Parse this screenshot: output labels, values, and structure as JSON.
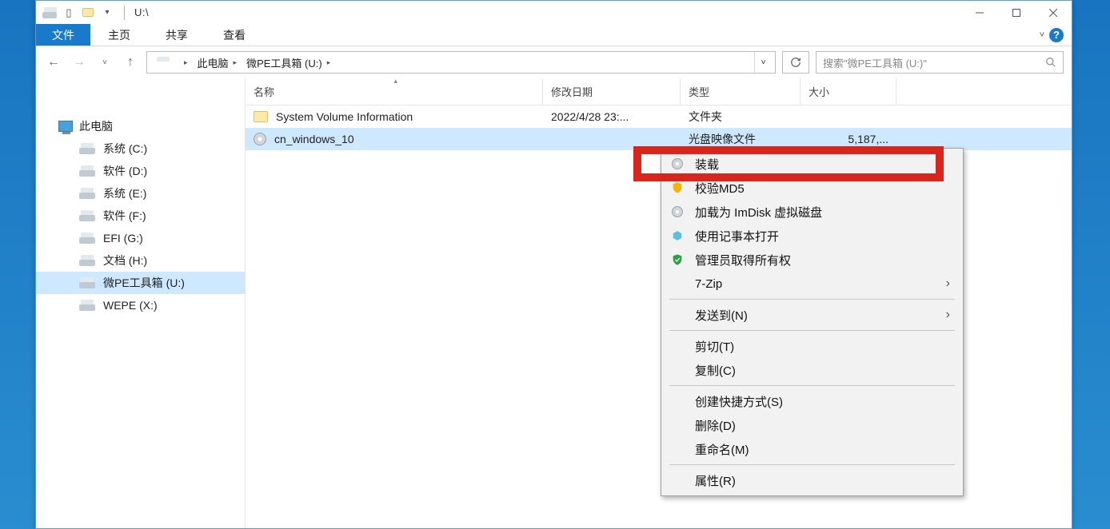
{
  "titlebar": {
    "path": "U:\\"
  },
  "ribbon": {
    "file": "文件",
    "home": "主页",
    "share": "共享",
    "view": "查看"
  },
  "breadcrumb": {
    "root": "此电脑",
    "drive": "微PE工具箱 (U:)"
  },
  "search": {
    "placeholder": "搜索\"微PE工具箱 (U:)\""
  },
  "columns": {
    "name": "名称",
    "date": "修改日期",
    "type": "类型",
    "size": "大小"
  },
  "sidebar": {
    "root": "此电脑",
    "items": [
      {
        "label": "系统 (C:)"
      },
      {
        "label": "软件 (D:)"
      },
      {
        "label": "系统 (E:)"
      },
      {
        "label": "软件 (F:)"
      },
      {
        "label": "EFI (G:)"
      },
      {
        "label": "文档 (H:)"
      },
      {
        "label": "微PE工具箱 (U:)"
      },
      {
        "label": "WEPE (X:)"
      }
    ]
  },
  "files": [
    {
      "name": "System Volume Information",
      "date": "2022/4/28 23:...",
      "type": "文件夹",
      "size": ""
    },
    {
      "name": "cn_windows_10",
      "date": "",
      "type": "光盘映像文件",
      "size": "5,187,..."
    }
  ],
  "context_menu": {
    "items": [
      {
        "label": "装载",
        "icon": "disc"
      },
      {
        "label": "校验MD5",
        "icon": "shield-yellow"
      },
      {
        "label": "加载为 ImDisk 虚拟磁盘",
        "icon": "disc"
      },
      {
        "label": "使用记事本打开",
        "icon": "cube"
      },
      {
        "label": "管理员取得所有权",
        "icon": "shield-green"
      },
      {
        "label": "7-Zip",
        "submenu": true
      },
      {
        "label": "发送到(N)",
        "submenu": true
      },
      {
        "label": "剪切(T)"
      },
      {
        "label": "复制(C)"
      },
      {
        "label": "创建快捷方式(S)"
      },
      {
        "label": "删除(D)"
      },
      {
        "label": "重命名(M)"
      },
      {
        "label": "属性(R)"
      }
    ]
  }
}
